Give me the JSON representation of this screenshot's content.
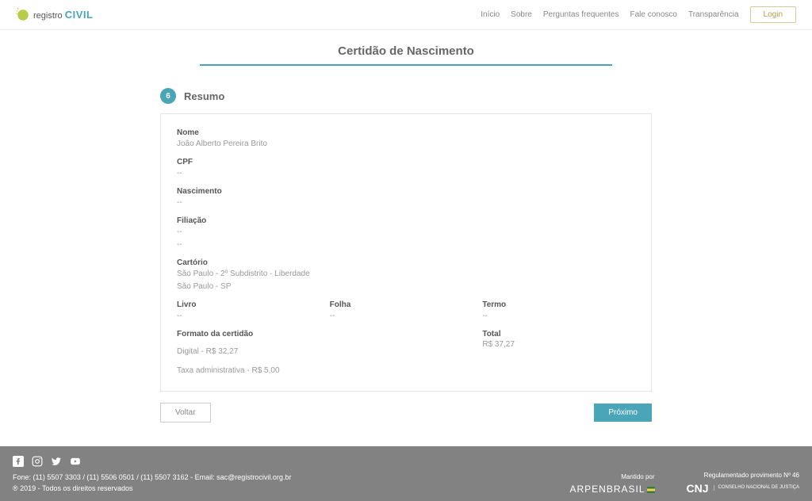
{
  "header": {
    "logo_top": "registro",
    "logo_main": "CIVIL",
    "nav": {
      "inicio": "Início",
      "sobre": "Sobre",
      "faq": "Perguntas frequentes",
      "fale": "Fale conosco",
      "transp": "Transparência"
    },
    "login": "Login"
  },
  "page": {
    "title": "Certidão de Nascimento",
    "step_number": "6",
    "step_title": "Resumo"
  },
  "summary": {
    "nome_label": "Nome",
    "nome": "João Alberto Pereira Brito",
    "cpf_label": "CPF",
    "cpf": "--",
    "nascimento_label": "Nascimento",
    "nascimento": "--",
    "filiacao_label": "Filiação",
    "filiacao1": "--",
    "filiacao2": "--",
    "cartorio_label": "Cartório",
    "cartorio1": "São Paulo - 2º Subdistrito - Liberdade",
    "cartorio2": "São Paulo - SP",
    "livro_label": "Livro",
    "livro": "--",
    "folha_label": "Folha",
    "folha": "--",
    "termo_label": "Termo",
    "termo": "--",
    "formato_label": "Formato da certidão",
    "formato_digital": "Digital - R$ 32,27",
    "taxa": "Taxa administrativa - R$ 5,00",
    "total_label": "Total",
    "total": "R$ 37,27"
  },
  "actions": {
    "voltar": "Voltar",
    "proximo": "Próximo"
  },
  "footer": {
    "phones": "Fone: (11) 5507 3303 / (11) 5506 0501 / (11) 5507 3162 - Email: sac@registrocivil.org.br",
    "copyright": "® 2019 - Todos os direitos reservados",
    "mantido": "Mantido por",
    "arpen1": "ARPEN",
    "arpen2": "BRASIL",
    "regul": "Regulamentado provimento Nº 46",
    "cnj": "CNJ",
    "cnj_sub": "CONSELHO NACIONAL DE JUSTIÇA"
  }
}
